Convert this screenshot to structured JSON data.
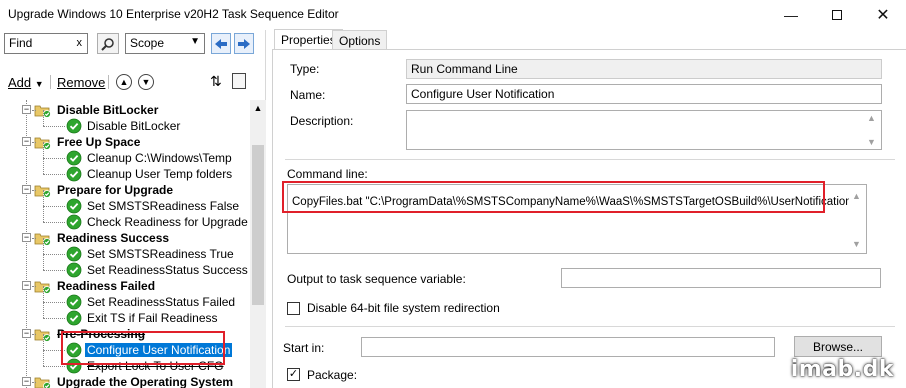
{
  "window": {
    "title": "Upgrade Windows 10 Enterprise v20H2 Task Sequence Editor",
    "minimize_icon": "minimize-icon",
    "maximize_icon": "maximize-icon",
    "close_icon": "close-icon"
  },
  "left": {
    "find_value": "Find",
    "find_clear": "x",
    "scope_value": "Scope",
    "add_label": "Add",
    "remove_label": "Remove",
    "tree": [
      {
        "type": "group",
        "label": "Disable BitLocker"
      },
      {
        "type": "step",
        "label": "Disable BitLocker"
      },
      {
        "type": "group",
        "label": "Free Up Space"
      },
      {
        "type": "step",
        "label": "Cleanup C:\\Windows\\Temp"
      },
      {
        "type": "step",
        "label": "Cleanup User Temp folders"
      },
      {
        "type": "group",
        "label": "Prepare for Upgrade"
      },
      {
        "type": "step",
        "label": "Set SMSTSReadiness False"
      },
      {
        "type": "step",
        "label": "Check Readiness for Upgrade"
      },
      {
        "type": "group",
        "label": "Readiness Success"
      },
      {
        "type": "step",
        "label": "Set SMSTSReadiness True"
      },
      {
        "type": "step",
        "label": "Set ReadinessStatus Success"
      },
      {
        "type": "group",
        "label": "Readiness Failed"
      },
      {
        "type": "step",
        "label": "Set ReadinessStatus Failed"
      },
      {
        "type": "step",
        "label": "Exit TS if Fail Readiness"
      },
      {
        "type": "group",
        "label": "Pre-Processing"
      },
      {
        "type": "step",
        "label": "Configure User Notification",
        "selected": true
      },
      {
        "type": "step",
        "label": "Export Lock To User CFG"
      },
      {
        "type": "group",
        "label": "Upgrade the Operating System"
      }
    ]
  },
  "right": {
    "tabs": [
      "Properties",
      "Options"
    ],
    "type_label": "Type:",
    "type_value": "Run Command Line",
    "name_label": "Name:",
    "name_value": "Configure User Notification",
    "description_label": "Description:",
    "description_value": "",
    "command_line_label": "Command line:",
    "command_line_value": "CopyFiles.bat \"C:\\ProgramData\\%SMSTSCompanyName%\\WaaS\\%SMSTSTargetOSBuild%\\UserNotification\"",
    "output_var_label": "Output to task sequence variable:",
    "output_var_value": "",
    "disable64_label": "Disable 64-bit file system redirection",
    "disable64_checked": false,
    "start_in_label": "Start in:",
    "start_in_value": "",
    "browse_label": "Browse...",
    "package_label": "Package:",
    "package_checked": true
  },
  "watermark": "imab.dk",
  "colors": {
    "highlight": "#e0202a",
    "selection": "#0078d7",
    "success_green": "#2ea52e",
    "folder_yellow": "#e8c766"
  }
}
